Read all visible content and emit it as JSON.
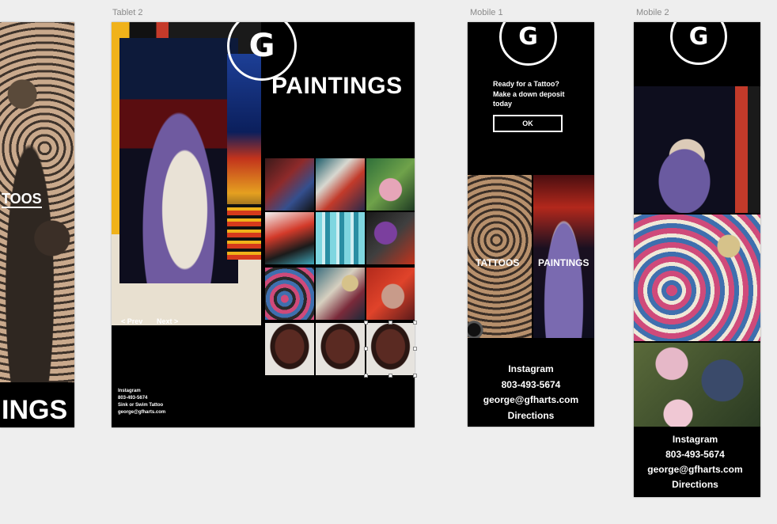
{
  "artboards": {
    "tablet2": {
      "label": "Tablet 2"
    },
    "mobile1": {
      "label": "Mobile 1"
    },
    "mobile2": {
      "label": "Mobile 2"
    }
  },
  "left_partial": {
    "tattoos_label": "TOOS",
    "paintings_label": "INGS"
  },
  "tablet2": {
    "logo": "G",
    "heading": "PAINTINGS",
    "prev": "< Prev",
    "next": "Next >",
    "footer": [
      "Instagram",
      "803-493-5674",
      "Sink or Swim Tattoo",
      "george@gfharts.com"
    ]
  },
  "mobile1": {
    "logo": "G",
    "cta_text": [
      "Ready for a Tattoo?",
      "Make a down deposit",
      "today"
    ],
    "ok_label": "OK",
    "tattoos_label": "TATTOOS",
    "paintings_label": "PAINTINGS",
    "footer": [
      "Instagram",
      "803-493-5674",
      "george@gfharts.com",
      "Directions"
    ]
  },
  "mobile2": {
    "logo": "G",
    "footer": [
      "Instagram",
      "803-493-5674",
      "george@gfharts.com",
      "Directions"
    ]
  },
  "colors": {
    "canvas": "#eeeeee",
    "board": "#000000",
    "text": "#ffffff",
    "label": "#8a8a8a"
  }
}
